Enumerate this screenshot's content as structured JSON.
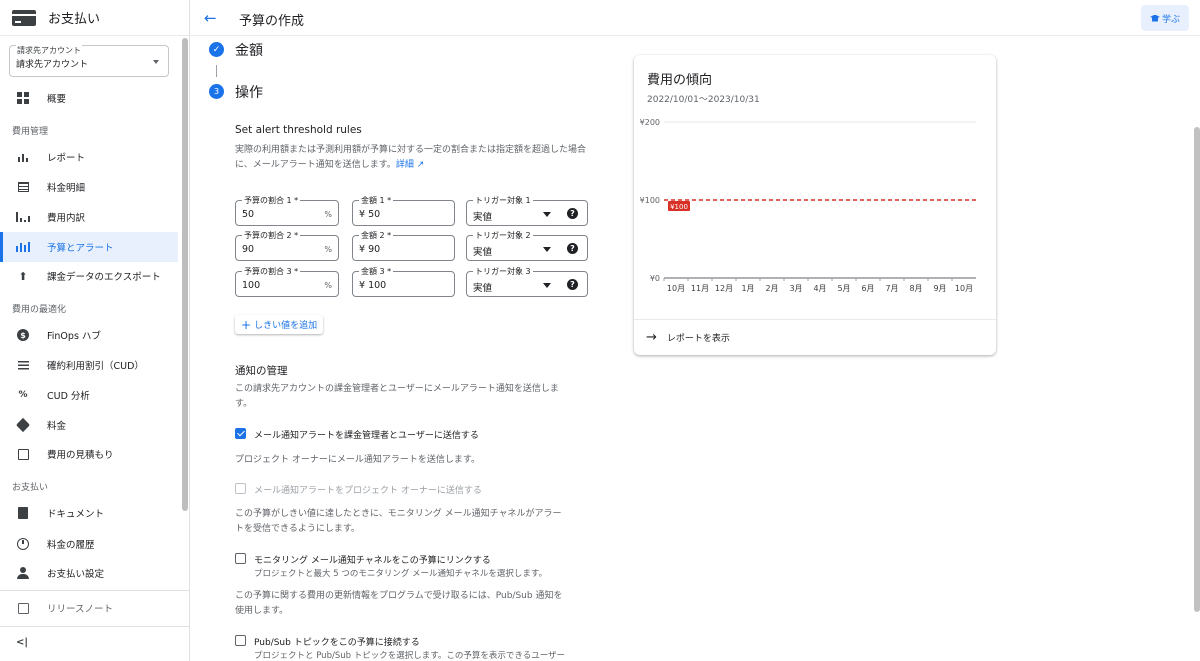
{
  "sidebar": {
    "title": "お支払い",
    "account": {
      "label": "請求先アカウント",
      "value": "請求先アカウント"
    },
    "items": [
      {
        "label": "概要",
        "icon": "dashboard-icon"
      },
      {
        "label": "レポート",
        "icon": "bar-chart-icon"
      },
      {
        "label": "料金明細",
        "icon": "table-icon"
      },
      {
        "label": "費用内訳",
        "icon": "waterfall-icon"
      },
      {
        "label": "予算とアラート",
        "icon": "budget-icon",
        "active": true
      },
      {
        "label": "課金データのエクスポート",
        "icon": "export-icon"
      },
      {
        "label": "FinOps ハブ",
        "icon": "dollar-icon"
      },
      {
        "label": "確約利用割引（CUD）",
        "icon": "list-icon"
      },
      {
        "label": "CUD 分析",
        "icon": "percent-icon"
      },
      {
        "label": "料金",
        "icon": "tag-icon"
      },
      {
        "label": "費用の見積もり",
        "icon": "calculator-icon"
      },
      {
        "label": "ドキュメント",
        "icon": "document-icon"
      },
      {
        "label": "料金の履歴",
        "icon": "history-icon"
      },
      {
        "label": "お支払い設定",
        "icon": "person-icon"
      },
      {
        "label": "リリースノート",
        "icon": "notes-icon"
      }
    ],
    "sections": [
      "費用管理",
      "費用の最適化",
      "お支払い"
    ],
    "collapse_label": "<|"
  },
  "topbar": {
    "title": "予算の作成",
    "learn_label": "学ぶ"
  },
  "steps": {
    "amount": "金額",
    "actions": "操作",
    "actions_num": "3"
  },
  "rules": {
    "heading": "Set alert threshold rules",
    "desc1": "実際の利用額または予測利用額が予算に対する一定の割合または指定額を超過した場合",
    "desc2": "に、メールアラート通知を送信します。",
    "link": "詳細",
    "rows": [
      {
        "pct_label": "予算の割合 1 *",
        "pct": "50",
        "amt_label": "金額 1 *",
        "amt": "¥ 50",
        "trig_label": "トリガー対象 1",
        "trig": "実値"
      },
      {
        "pct_label": "予算の割合 2 *",
        "pct": "90",
        "amt_label": "金額 2 *",
        "amt": "¥ 90",
        "trig_label": "トリガー対象 2",
        "trig": "実値"
      },
      {
        "pct_label": "予算の割合 3 *",
        "pct": "100",
        "amt_label": "金額 3 *",
        "amt": "¥ 100",
        "trig_label": "トリガー対象 3",
        "trig": "実値"
      }
    ],
    "pct_suffix": "%",
    "add_label": "しきい値を追加"
  },
  "notify": {
    "heading": "通知の管理",
    "desc1a": "この請求先アカウントの課金管理者とユーザーにメールアラート通知を送信しま",
    "desc1b": "す。",
    "cb1": "メール通知アラートを課金管理者とユーザーに送信する",
    "desc2": "プロジェクト オーナーにメール通知アラートを送信します。",
    "cb2": "メール通知アラートをプロジェクト オーナーに送信する",
    "desc3a": "この予算がしきい値に達したときに、モニタリング メール通知チャネルがアラー",
    "desc3b": "トを受信できるようにします。",
    "cb3": "モニタリング メール通知チャネルをこの予算にリンクする",
    "cb3_sub": "プロジェクトと最大 5 つのモニタリング メール通知チャネルを選択します。",
    "desc4a": "この予算に関する費用の更新情報をプログラムで受け取るには、Pub/Sub 通知を",
    "desc4b": "使用します。",
    "cb4": "Pub/Sub トピックをこの予算に接続する",
    "cb4_sub": "プロジェクトと Pub/Sub トピックを選択します。この予算を表示できるユーザー"
  },
  "card": {
    "title": "費用の傾向",
    "subtitle": "2022/10/01〜2023/10/31",
    "footer": "レポートを表示"
  },
  "chart_data": {
    "type": "line",
    "categories": [
      "10月",
      "11月",
      "12月",
      "1月",
      "2月",
      "3月",
      "4月",
      "5月",
      "6月",
      "7月",
      "8月",
      "9月",
      "10月"
    ],
    "y_ticks": [
      "¥200",
      "¥100",
      "¥0"
    ],
    "ylim": [
      0,
      200
    ],
    "budget_line": 100,
    "budget_label": "¥100",
    "budget_color": "#d93025"
  }
}
